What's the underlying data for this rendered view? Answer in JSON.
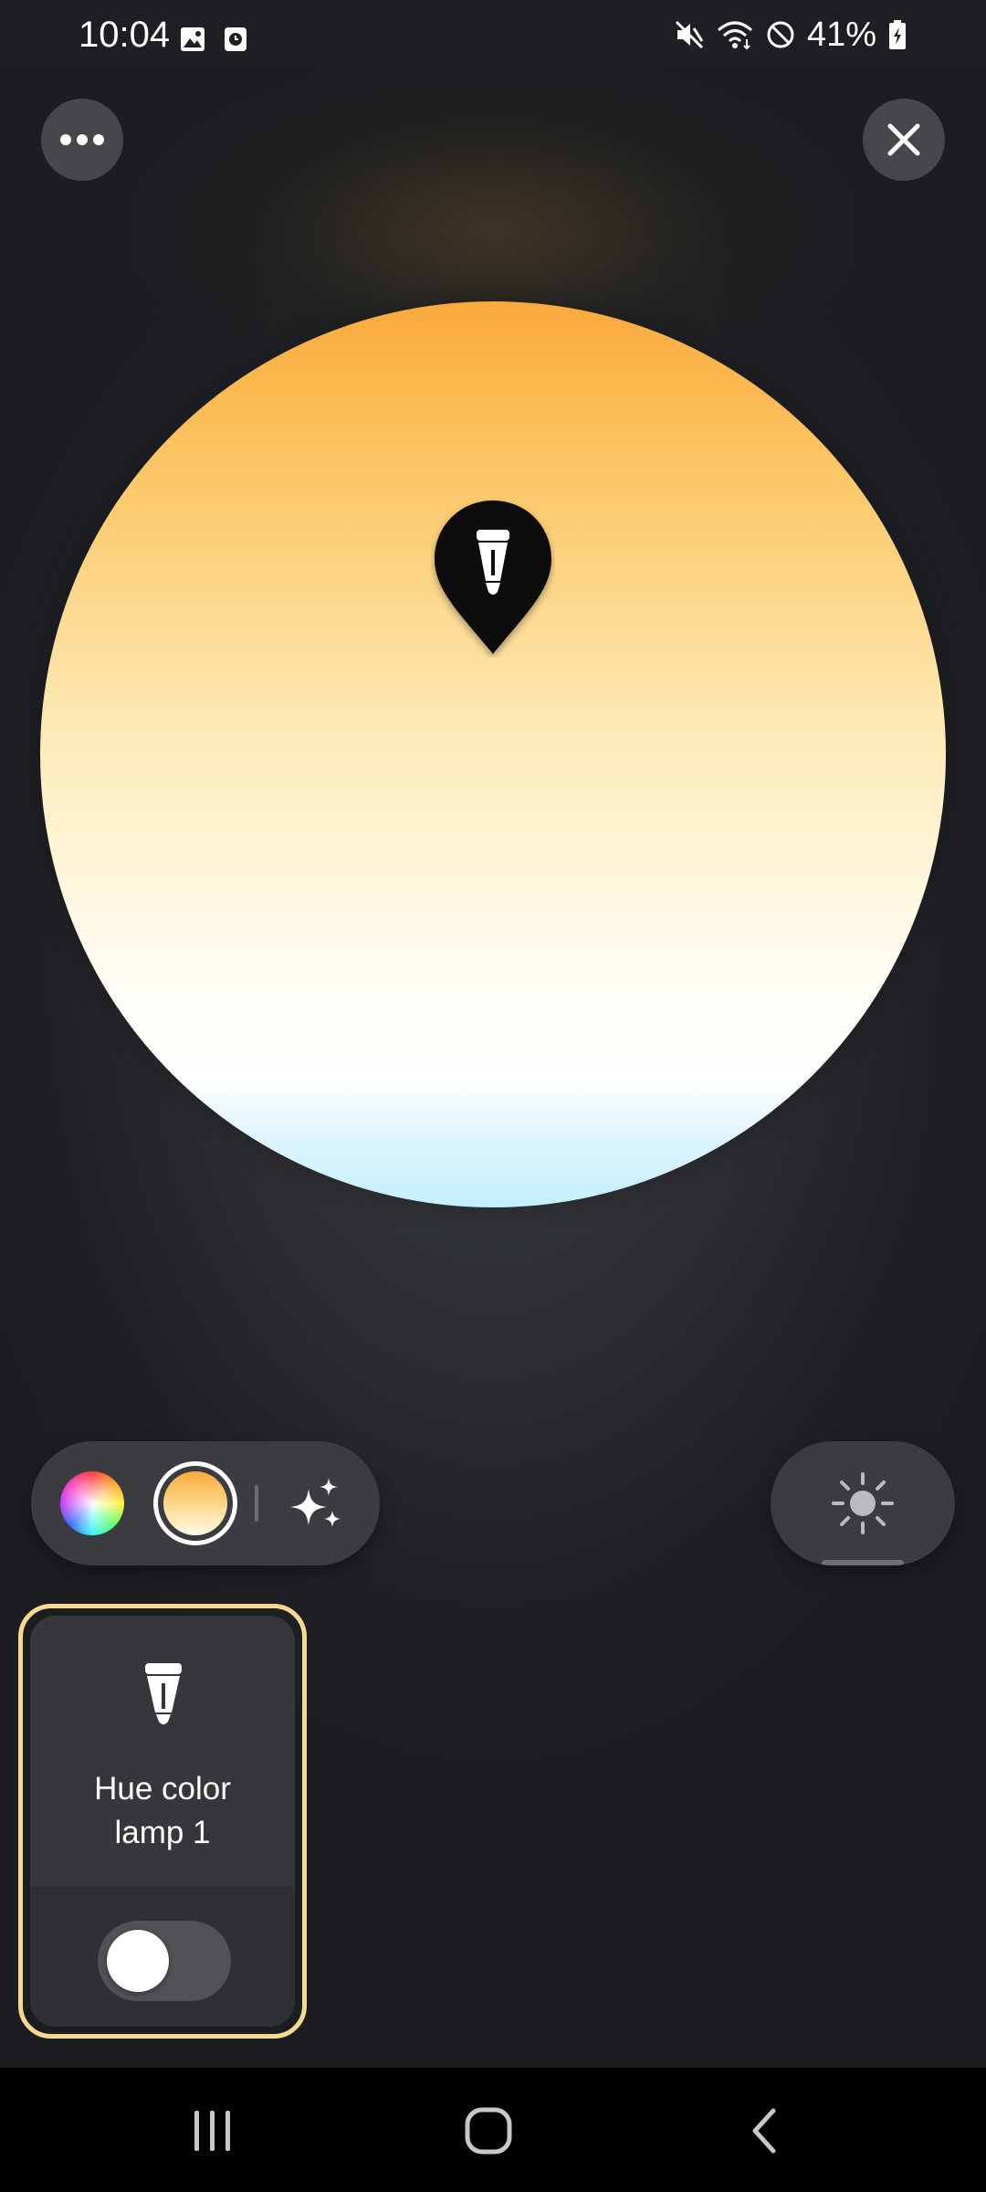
{
  "status_bar": {
    "time": "10:04",
    "battery": "41%",
    "icons": [
      "gallery-icon",
      "clock-app-icon",
      "mute-icon",
      "wifi-icon",
      "do-not-disturb-icon",
      "battery-charging-icon"
    ]
  },
  "header": {
    "more_icon": "more-horizontal-icon",
    "close_icon": "close-icon"
  },
  "color_picker": {
    "mode": "white-ambiance",
    "gradient_colors": [
      "#fba93c",
      "#fcd27e",
      "#fef4d4",
      "#ffffff",
      "#c3efff"
    ],
    "pin_icon": "bulb-icon"
  },
  "mode_selector": {
    "options": [
      "color-wheel",
      "white-temperature",
      "effects"
    ],
    "selected": "white-temperature"
  },
  "brightness": {
    "icon": "sun-icon"
  },
  "light_card": {
    "name": "Hue color\nlamp 1",
    "icon": "bulb-icon",
    "on": false,
    "border_color": "#f6d98e"
  },
  "nav": {
    "recents_icon": "recents-icon",
    "home_icon": "home-icon",
    "back_icon": "back-icon"
  }
}
